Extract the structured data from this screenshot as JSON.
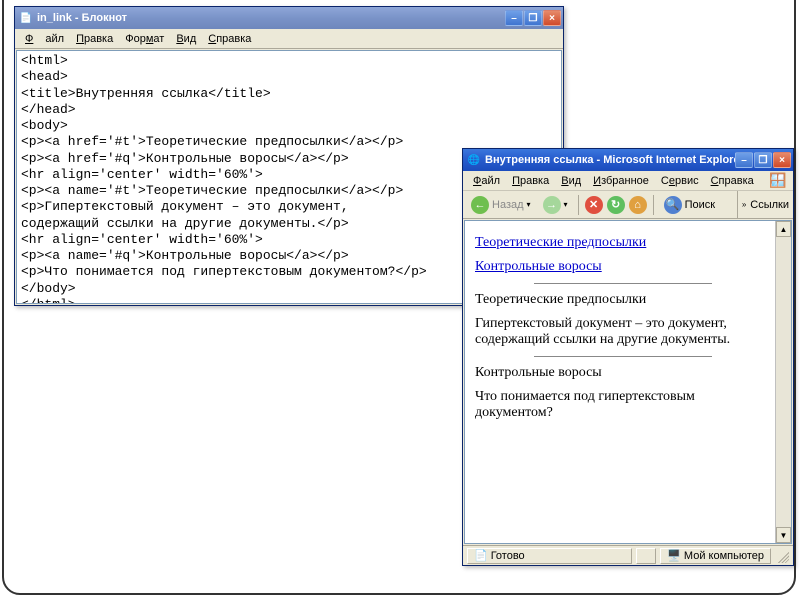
{
  "notepad": {
    "title": "in_link - Блокнот",
    "menu": [
      "Файл",
      "Правка",
      "Формат",
      "Вид",
      "Справка"
    ],
    "menu_u": [
      "Ф",
      "П",
      "м",
      "В",
      "С"
    ],
    "lines": [
      "<html>",
      "<head>",
      "<title>Внутренняя ссылка</title>",
      "</head>",
      "<body>",
      "<p><a href='#t'>Теоретические предпосылки</a></p>",
      "<p><a href='#q'>Контрольные воросы</a></p>",
      "<hr align='center' width='60%'>",
      "<p><a name='#t'>Теоретические предпосылки</a></p>",
      "<p>Гипертекстовый документ – это документ,",
      "содержащий ссылки на другие документы.</p>",
      "<hr align='center' width='60%'>",
      "<p><a name='#q'>Контрольные воросы</a></p>",
      "<p>Что понимается под гипертекстовым документом?</p>",
      "</body>",
      "</html>"
    ]
  },
  "ie": {
    "title": "Внутренняя ссылка - Microsoft Internet Explorer",
    "menu": [
      "Файл",
      "Правка",
      "Вид",
      "Избранное",
      "Сервис",
      "Справка"
    ],
    "menu_u": [
      "Ф",
      "П",
      "В",
      "И",
      "е",
      "С"
    ],
    "toolbar": {
      "back": "Назад",
      "search": "Поиск",
      "links": "Ссылки"
    },
    "page": {
      "link1": "Теоретические предпосылки",
      "link2": "Контрольные воросы",
      "h1": "Теоретические предпосылки",
      "para1": "Гипертекстовый документ – это документ, содержащий ссылки на другие документы.",
      "h2": "Контрольные воросы",
      "para2": "Что понимается под гипертекстовым документом?"
    },
    "status": {
      "ready": "Готово",
      "zone": "Мой компьютер"
    }
  }
}
